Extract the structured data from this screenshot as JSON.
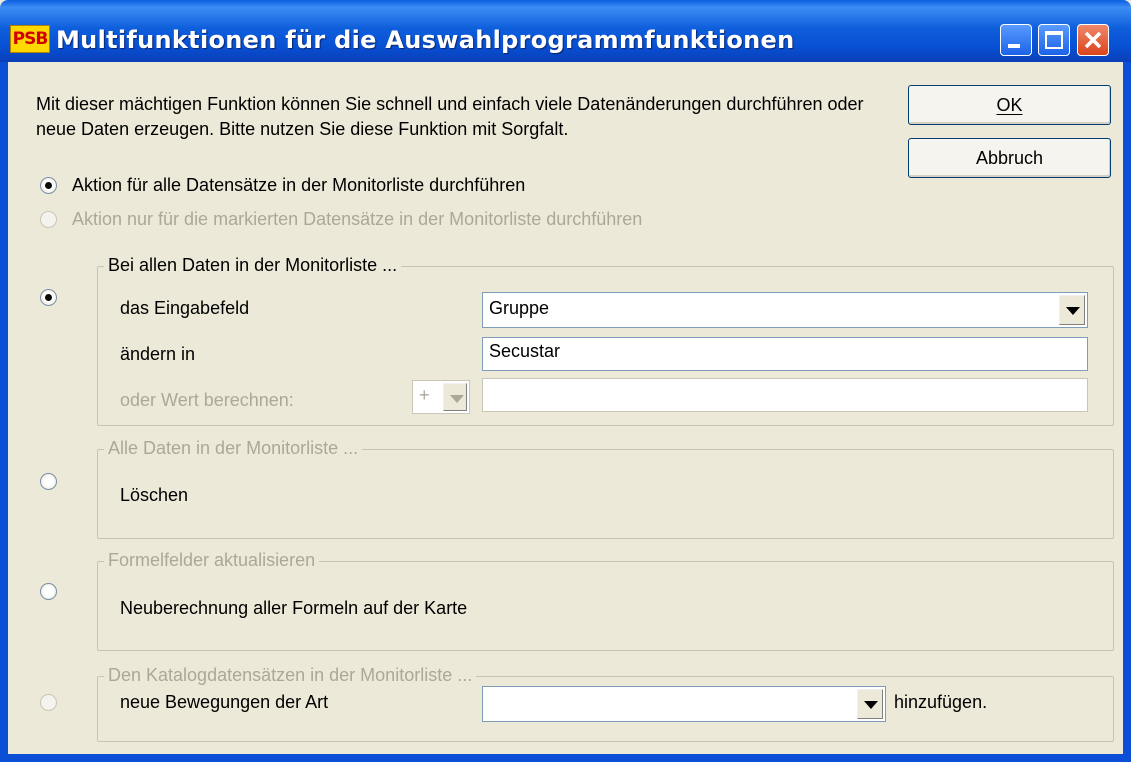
{
  "window": {
    "app_icon_text": "PSB",
    "title": "Multifunktionen für die Auswahlprogrammfunktionen",
    "controls": [
      "minimize-icon",
      "maximize-icon",
      "close-icon"
    ]
  },
  "intro": {
    "text": "Mit dieser mächtigen Funktion können Sie schnell und einfach viele Datenänderungen durchführen oder neue Daten erzeugen. Bitte nutzen Sie diese Funktion mit Sorgfalt."
  },
  "buttons": {
    "ok": "OK",
    "cancel": "Abbruch"
  },
  "scope": {
    "all": "Aktion für alle Datensätze in der Monitorliste durchführen",
    "marked": "Aktion nur für die markierten Datensätze in der Monitorliste durchführen"
  },
  "group_change": {
    "legend": "Bei allen Daten in der Monitorliste ...",
    "field_label": "das Eingabefeld",
    "field_value": "Gruppe",
    "change_label": "ändern in",
    "change_value": "Secustar",
    "calc_label": "oder Wert berechnen:",
    "calc_operator": "+",
    "calc_value": ""
  },
  "group_delete": {
    "legend": "Alle Daten in der Monitorliste ...",
    "action": "Löschen"
  },
  "group_formula": {
    "legend": "Formelfelder aktualisieren",
    "action": "Neuberechnung aller Formeln auf der Karte"
  },
  "group_catalog": {
    "legend": "Den Katalogdatensätzen in der Monitorliste ...",
    "label": "neue Bewegungen der Art",
    "value": "",
    "suffix": "hinzufügen."
  }
}
